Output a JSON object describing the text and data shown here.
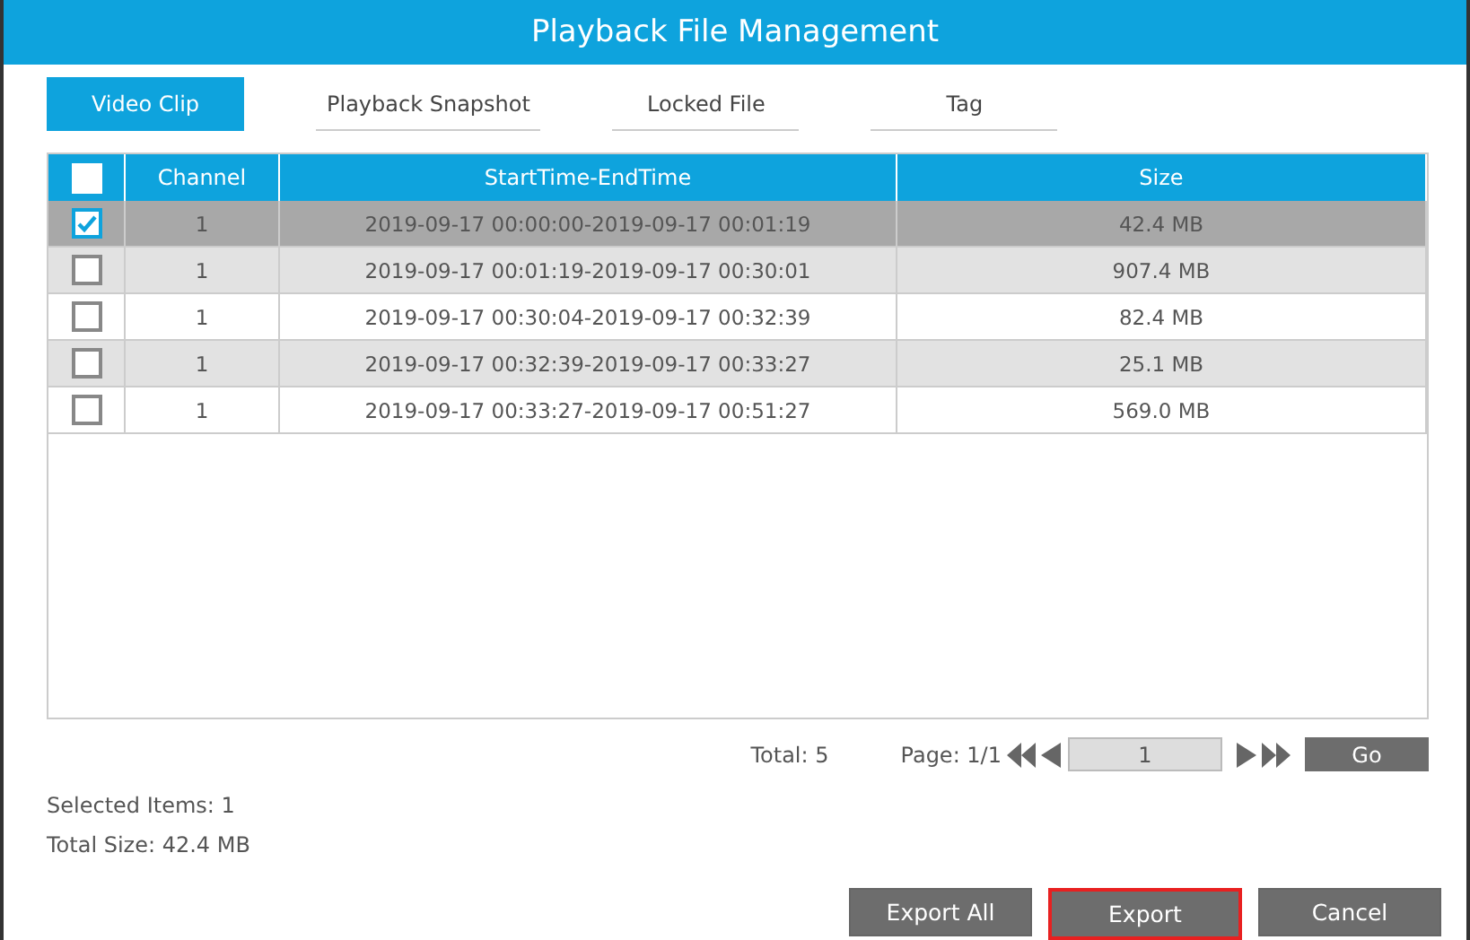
{
  "window": {
    "title": "Playback File Management"
  },
  "tabs": [
    {
      "label": "Video Clip",
      "selected": true
    },
    {
      "label": "Playback Snapshot",
      "selected": false
    },
    {
      "label": "Locked File",
      "selected": false
    },
    {
      "label": "Tag",
      "selected": false
    }
  ],
  "table": {
    "select_all_checked": false,
    "columns": [
      "Channel",
      "StartTime-EndTime",
      "Size"
    ],
    "rows": [
      {
        "checked": true,
        "selected": true,
        "cells": [
          "1",
          "2019-09-17 00:00:00-2019-09-17 00:01:19",
          "42.4 MB"
        ]
      },
      {
        "checked": false,
        "selected": false,
        "cells": [
          "1",
          "2019-09-17 00:01:19-2019-09-17 00:30:01",
          "907.4 MB"
        ]
      },
      {
        "checked": false,
        "selected": false,
        "cells": [
          "1",
          "2019-09-17 00:30:04-2019-09-17 00:32:39",
          "82.4 MB"
        ]
      },
      {
        "checked": false,
        "selected": false,
        "cells": [
          "1",
          "2019-09-17 00:32:39-2019-09-17 00:33:27",
          "25.1 MB"
        ]
      },
      {
        "checked": false,
        "selected": false,
        "cells": [
          "1",
          "2019-09-17 00:33:27-2019-09-17 00:51:27",
          "569.0 MB"
        ]
      }
    ]
  },
  "pagination": {
    "total": "Total: 5",
    "page": "Page: 1/1",
    "page_input": "1",
    "go": "Go"
  },
  "summary": [
    "Selected Items: 1",
    "Total Size: 42.4 MB"
  ],
  "buttons": [
    {
      "label": "Export All",
      "focused": false
    },
    {
      "label": "Export",
      "focused": true
    },
    {
      "label": "Cancel",
      "focused": false
    }
  ]
}
